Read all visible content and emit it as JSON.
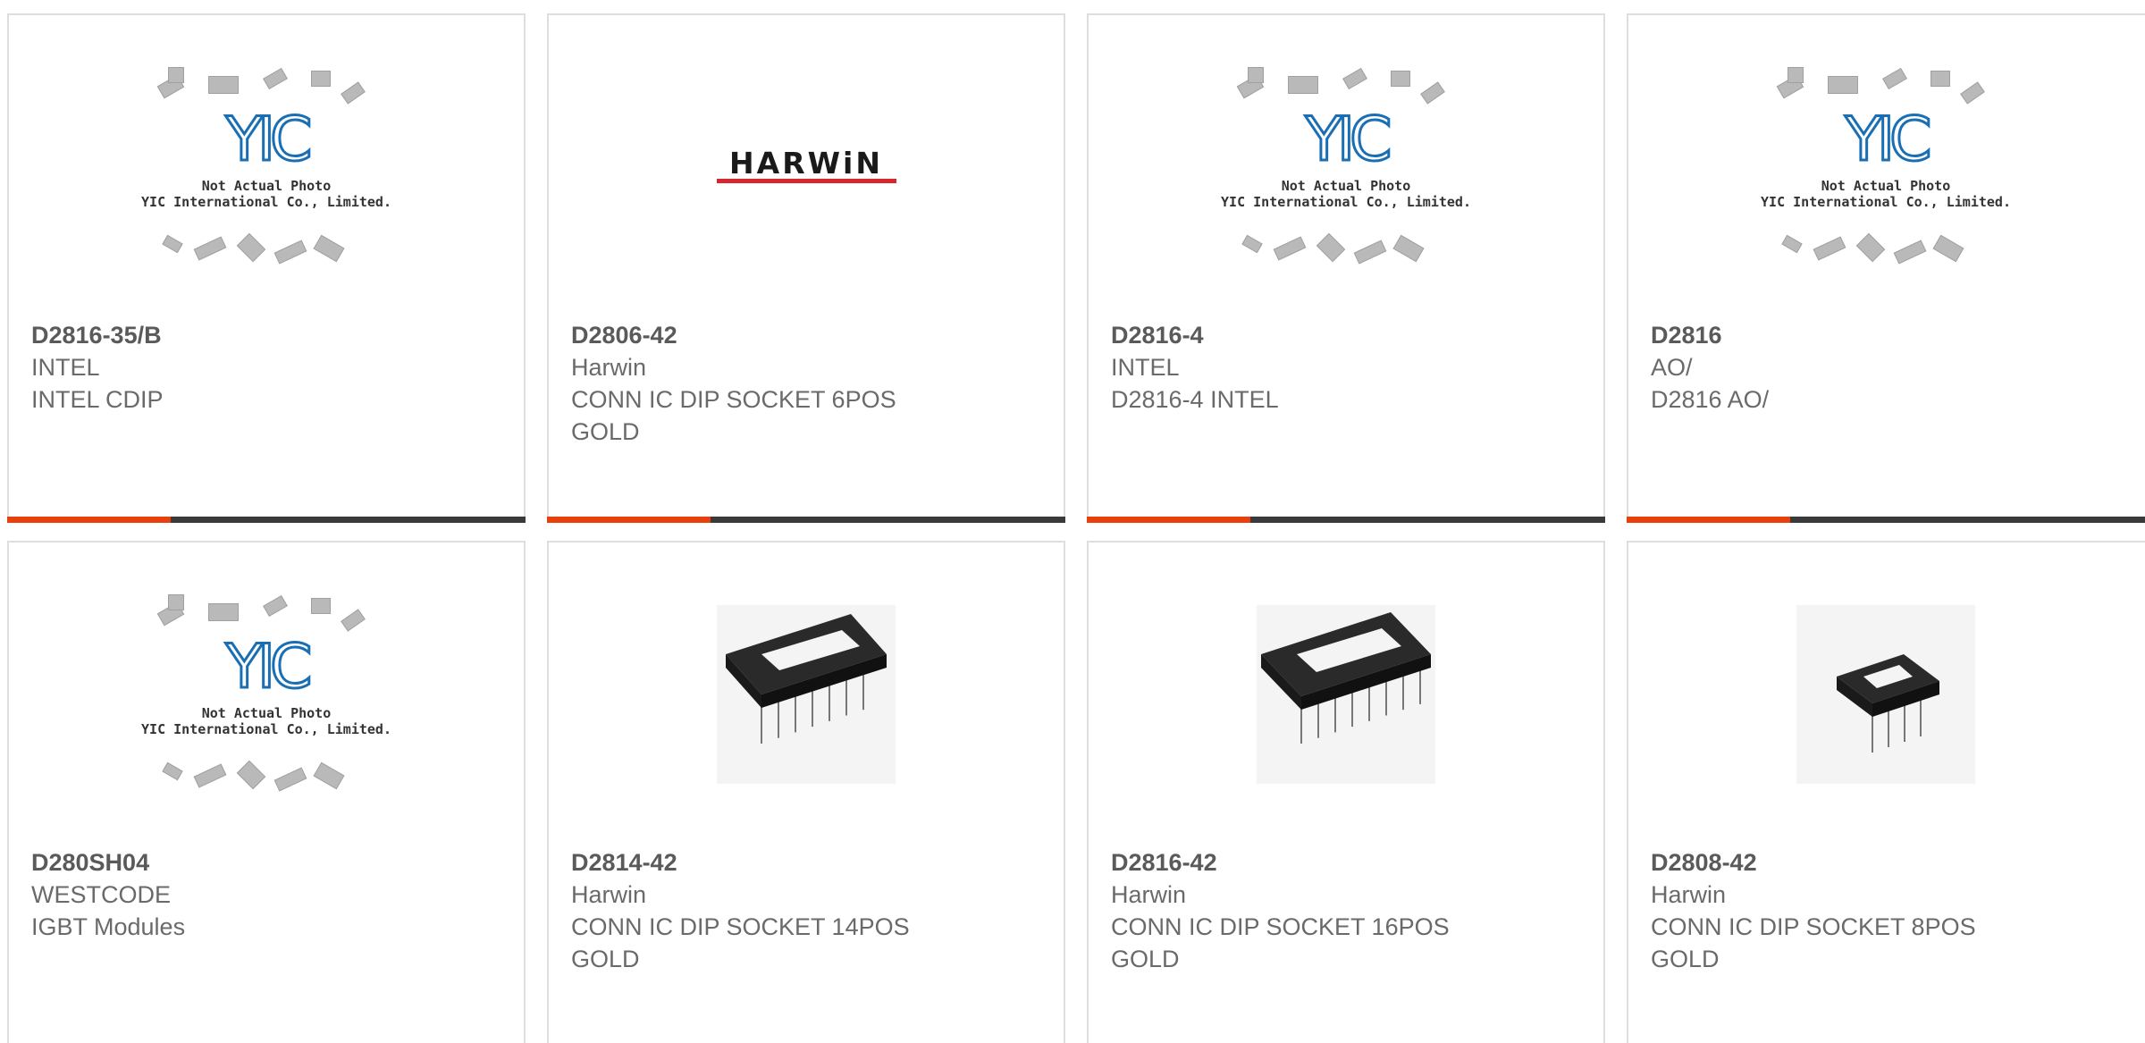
{
  "products": [
    {
      "part": "D2816-35/B",
      "manufacturer": "INTEL",
      "description": [
        "INTEL CDIP"
      ],
      "image": "yic-placeholder"
    },
    {
      "part": "D2806-42",
      "manufacturer": "Harwin",
      "description": [
        "CONN IC DIP SOCKET 6POS",
        "GOLD"
      ],
      "image": "harwin-logo"
    },
    {
      "part": "D2816-4",
      "manufacturer": "INTEL",
      "description": [
        "D2816-4 INTEL"
      ],
      "image": "yic-placeholder"
    },
    {
      "part": "D2816",
      "manufacturer": "AO/",
      "description": [
        "D2816 AO/"
      ],
      "image": "yic-placeholder"
    },
    {
      "part": "D280SH04",
      "manufacturer": "WESTCODE",
      "description": [
        "IGBT Modules"
      ],
      "image": "yic-placeholder"
    },
    {
      "part": "D2814-42",
      "manufacturer": "Harwin",
      "description": [
        "CONN IC DIP SOCKET 14POS",
        "GOLD"
      ],
      "image": "dip-socket-14"
    },
    {
      "part": "D2816-42",
      "manufacturer": "Harwin",
      "description": [
        "CONN IC DIP SOCKET 16POS",
        "GOLD"
      ],
      "image": "dip-socket-16"
    },
    {
      "part": "D2808-42",
      "manufacturer": "Harwin",
      "description": [
        "CONN IC DIP SOCKET 8POS",
        "GOLD"
      ],
      "image": "dip-socket-8"
    }
  ],
  "placeholder": {
    "caption1": "Not Actual Photo",
    "caption2": "YIC International Co., Limited.",
    "logo": "YIC"
  },
  "harwin_logo_text": "HARWiN",
  "colors": {
    "accent": "#e8400c",
    "bar": "#3a3a3a",
    "border": "#dedede",
    "yic_blue": "#1a6fb4",
    "harwin_red": "#d9262c"
  }
}
